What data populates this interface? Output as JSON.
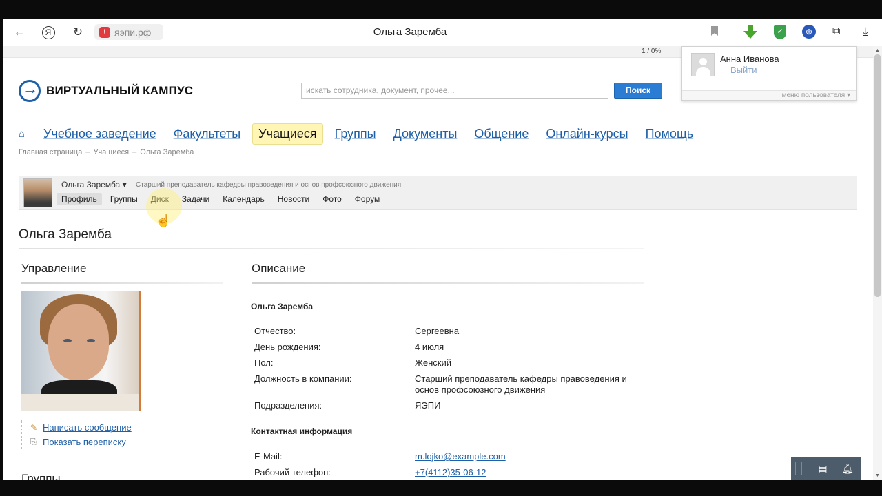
{
  "browser": {
    "url": "яэпи.рф",
    "tab_title": "Ольга Заремба",
    "zoom_status": "1 / 0%"
  },
  "site": {
    "logo_text": "ВИРТУАЛЬНЫЙ КАМПУС",
    "search_placeholder": "искать сотрудника, документ, прочее...",
    "search_button": "Поиск"
  },
  "user_menu": {
    "name": "Анна Иванова",
    "logout": "Выйти",
    "footer": "меню пользователя ▾"
  },
  "nav": {
    "items": [
      "Учебное заведение",
      "Факультеты",
      "Учащиеся",
      "Группы",
      "Документы",
      "Общение",
      "Онлайн-курсы",
      "Помощь"
    ],
    "active": "Учащиеся"
  },
  "breadcrumb": [
    "Главная страница",
    "Учащиеся",
    "Ольга Заремба"
  ],
  "profile_bar": {
    "name": "Ольга Заремба ▾",
    "position": "Старший преподаватель кафедры правоведения и основ профсоюзного движения",
    "tabs": [
      "Профиль",
      "Группы",
      "Диск",
      "Задачи",
      "Календарь",
      "Новости",
      "Фото",
      "Форум"
    ]
  },
  "page_title": "Ольга Заремба",
  "left": {
    "heading": "Управление",
    "actions": [
      "Написать сообщение",
      "Показать переписку"
    ],
    "groups_heading": "Группы"
  },
  "description": {
    "heading": "Описание",
    "person_name": "Ольга Заремба",
    "rows": [
      {
        "label": "Отчество:",
        "value": "Сергеевна"
      },
      {
        "label": "День рождения:",
        "value": "4 июля"
      },
      {
        "label": "Пол:",
        "value": "Женский"
      },
      {
        "label": "Должность в компании:",
        "value": "Старший преподаватель кафедры правоведения и основ профсоюзного движения"
      },
      {
        "label": "Подразделения:",
        "value": "ЯЭПИ"
      }
    ],
    "contact_heading": "Контактная информация",
    "contacts": [
      {
        "label": "E-Mail:",
        "value": "m.lojko@example.com"
      },
      {
        "label": "Рабочий телефон:",
        "value": "+7(4112)35-06-12"
      }
    ]
  }
}
